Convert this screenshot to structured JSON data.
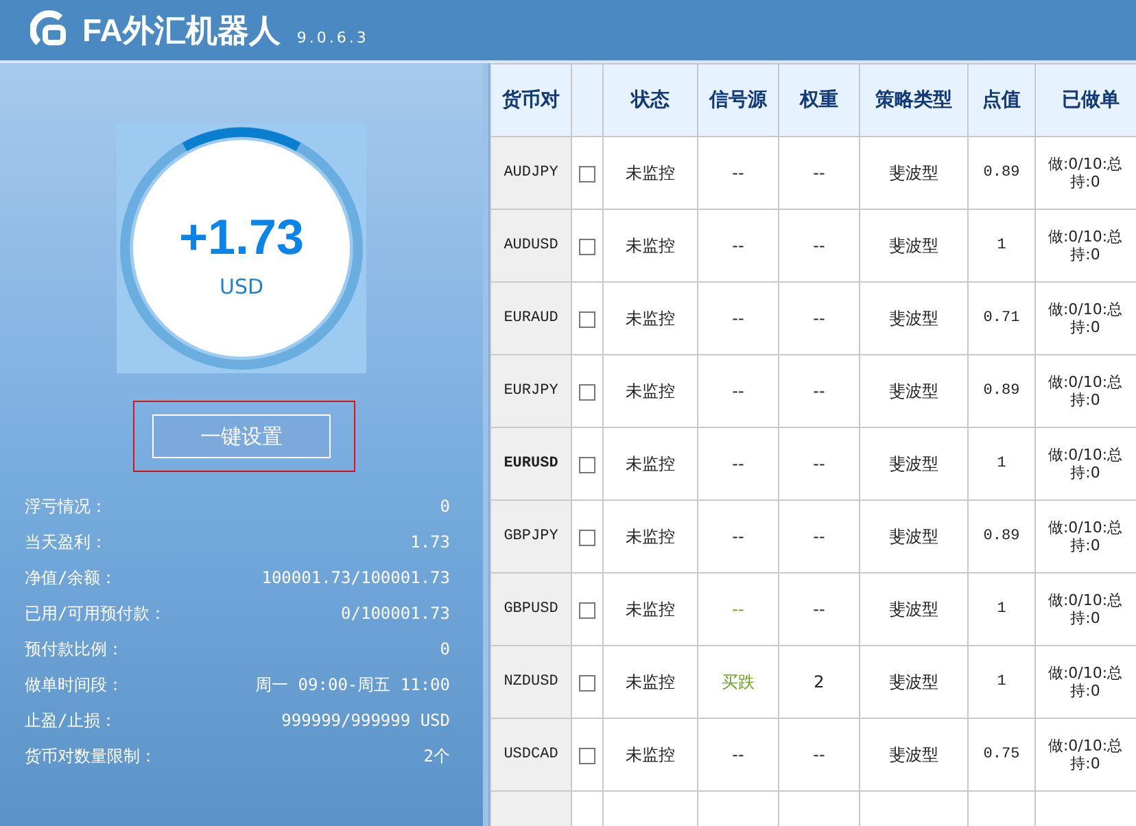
{
  "app": {
    "title": "FA外汇机器人",
    "version": "9.0.6.3"
  },
  "summary": {
    "amount": "+1.73",
    "currency": "USD",
    "button": "一键设置",
    "button_focused": true
  },
  "stats": [
    {
      "label": "浮亏情况：",
      "value": "0"
    },
    {
      "label": "当天盈利：",
      "value": "1.73"
    },
    {
      "label": "净值/余额：",
      "value": "100001.73/100001.73"
    },
    {
      "label": "已用/可用预付款：",
      "value": "0/100001.73"
    },
    {
      "label": "预付款比例：",
      "value": "0"
    },
    {
      "label": "做单时间段：",
      "value": "周一 09:00-周五 11:00"
    },
    {
      "label": "止盈/止损：",
      "value": "999999/999999 USD"
    },
    {
      "label": "货币对数量限制：",
      "value": "2个"
    }
  ],
  "table": {
    "columns": [
      "货币对",
      "状态",
      "信号源",
      "权重",
      "策略类型",
      "点值",
      "已做单"
    ],
    "rows": [
      {
        "pair": "AUDJPY",
        "current": false,
        "checked": false,
        "status": "未监控",
        "signal": "--",
        "signal_active": false,
        "weight": "--",
        "strategy": "斐波型",
        "pip": "0.89",
        "orders": "做:0/10:总持:0"
      },
      {
        "pair": "AUDUSD",
        "current": false,
        "checked": false,
        "status": "未监控",
        "signal": "--",
        "signal_active": false,
        "weight": "--",
        "strategy": "斐波型",
        "pip": "1",
        "orders": "做:0/10:总持:0"
      },
      {
        "pair": "EURAUD",
        "current": false,
        "checked": false,
        "status": "未监控",
        "signal": "--",
        "signal_active": false,
        "weight": "--",
        "strategy": "斐波型",
        "pip": "0.71",
        "orders": "做:0/10:总持:0"
      },
      {
        "pair": "EURJPY",
        "current": false,
        "checked": false,
        "status": "未监控",
        "signal": "--",
        "signal_active": false,
        "weight": "--",
        "strategy": "斐波型",
        "pip": "0.89",
        "orders": "做:0/10:总持:0"
      },
      {
        "pair": "EURUSD",
        "current": true,
        "checked": false,
        "status": "未监控",
        "signal": "--",
        "signal_active": false,
        "weight": "--",
        "strategy": "斐波型",
        "pip": "1",
        "orders": "做:0/10:总持:0"
      },
      {
        "pair": "GBPJPY",
        "current": false,
        "checked": false,
        "status": "未监控",
        "signal": "--",
        "signal_active": false,
        "weight": "--",
        "strategy": "斐波型",
        "pip": "0.89",
        "orders": "做:0/10:总持:0"
      },
      {
        "pair": "GBPUSD",
        "current": false,
        "checked": false,
        "status": "未监控",
        "signal": "--",
        "signal_active": true,
        "weight": "--",
        "strategy": "斐波型",
        "pip": "1",
        "orders": "做:0/10:总持:0"
      },
      {
        "pair": "NZDUSD",
        "current": false,
        "checked": false,
        "status": "未监控",
        "signal": "买跌",
        "signal_active": true,
        "weight": "2",
        "strategy": "斐波型",
        "pip": "1",
        "orders": "做:0/10:总持:0"
      },
      {
        "pair": "USDCAD",
        "current": false,
        "checked": false,
        "status": "未监控",
        "signal": "--",
        "signal_active": false,
        "weight": "--",
        "strategy": "斐波型",
        "pip": "0.75",
        "orders": "做:0/10:总持:0"
      }
    ]
  }
}
